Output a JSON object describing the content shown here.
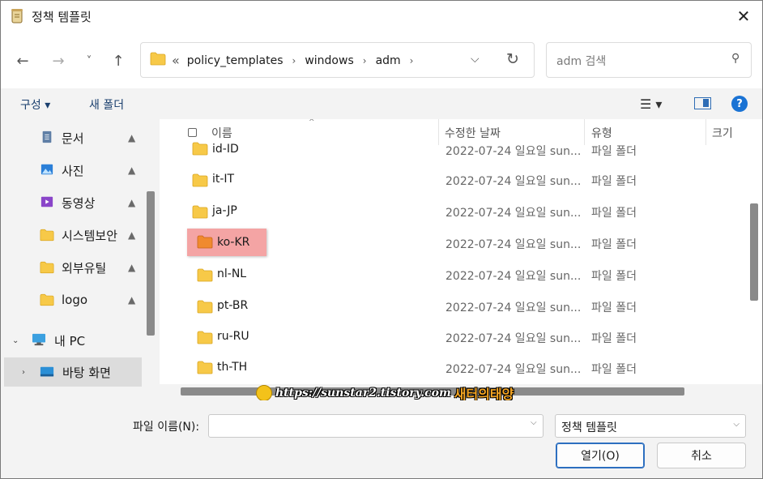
{
  "window": {
    "title": "정책 템플릿",
    "close_glyph": "✕"
  },
  "nav": {
    "back_glyph": "←",
    "forward_glyph": "→",
    "recent_glyph": "˅",
    "up_glyph": "↑",
    "overflow_glyph": "«",
    "breadcrumbs": [
      "policy_templates",
      "windows",
      "adm"
    ],
    "crumb_sep": "›",
    "dropdown_glyph": "⌵",
    "refresh_glyph": "↻",
    "search_placeholder": "adm 검색",
    "search_glyph": "⚲"
  },
  "toolbar": {
    "organize_label": "구성 ▾",
    "new_folder_label": "새 폴더",
    "view_glyph": "☰ ▾",
    "help_glyph": "?"
  },
  "sidebar": {
    "items": [
      {
        "label": "문서",
        "icon": "document-icon",
        "pinned": true
      },
      {
        "label": "사진",
        "icon": "picture-icon",
        "pinned": true
      },
      {
        "label": "동영상",
        "icon": "video-icon",
        "pinned": true
      },
      {
        "label": "시스템보안",
        "icon": "folder-icon",
        "pinned": true
      },
      {
        "label": "외부유틸",
        "icon": "folder-icon",
        "pinned": true
      },
      {
        "label": "logo",
        "icon": "folder-icon",
        "pinned": true
      },
      {
        "label": "내 PC",
        "icon": "pc-icon",
        "expanded": true
      },
      {
        "label": "바탕 화면",
        "icon": "desktop-icon",
        "selected": true
      }
    ],
    "pin_glyph": "📌",
    "expand_glyph": "⌄",
    "collapse_glyph": "›"
  },
  "columns": {
    "name": "이름",
    "date": "수정한 날짜",
    "type": "유형",
    "size": "크기",
    "sort_glyph": "^"
  },
  "files": [
    {
      "name": "id-ID",
      "date": "2022-07-24 일요일 sun...",
      "type": "파일 폴더"
    },
    {
      "name": "it-IT",
      "date": "2022-07-24 일요일 sun...",
      "type": "파일 폴더"
    },
    {
      "name": "ja-JP",
      "date": "2022-07-24 일요일 sun...",
      "type": "파일 폴더"
    },
    {
      "name": "ko-KR",
      "date": "2022-07-24 일요일 sun...",
      "type": "파일 폴더",
      "highlighted": true
    },
    {
      "name": "nl-NL",
      "date": "2022-07-24 일요일 sun...",
      "type": "파일 폴더"
    },
    {
      "name": "pt-BR",
      "date": "2022-07-24 일요일 sun...",
      "type": "파일 폴더"
    },
    {
      "name": "ru-RU",
      "date": "2022-07-24 일요일 sun...",
      "type": "파일 폴더"
    },
    {
      "name": "th-TH",
      "date": "2022-07-24 일요일 sun...",
      "type": "파일 폴더"
    }
  ],
  "watermark": {
    "url": "https://sunstar2.tistory.com",
    "name": "새터의태양"
  },
  "bottom": {
    "filename_label": "파일 이름(N):",
    "filename_value": "",
    "filetype_value": "정책 템플릿",
    "open_label": "열기(O)",
    "cancel_label": "취소",
    "dropdown_glyph": "⌵"
  },
  "colors": {
    "folder": "#f7c948",
    "highlight": "#f4a4a4",
    "accent": "#1a73d4"
  }
}
